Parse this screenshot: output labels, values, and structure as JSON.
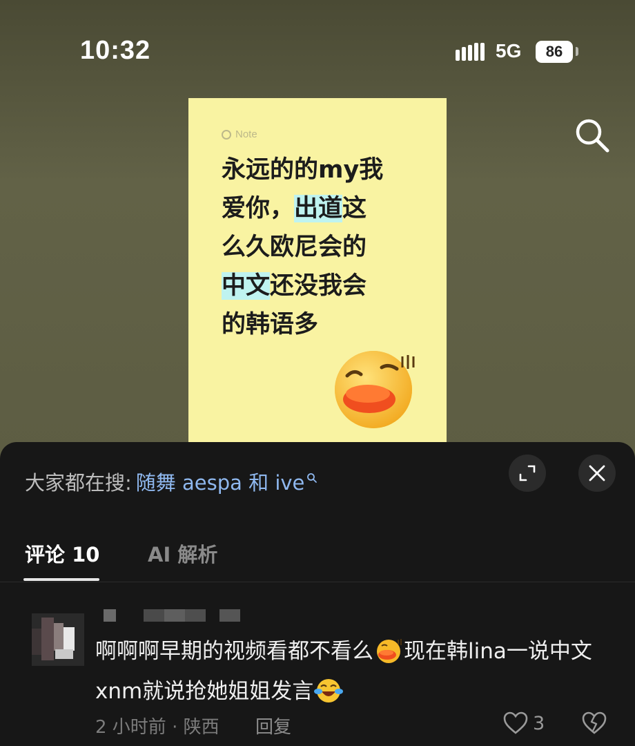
{
  "status_bar": {
    "time": "10:32",
    "network": "5G",
    "battery": "86"
  },
  "note": {
    "tag": "Note",
    "lines": [
      [
        {
          "t": "永远的的my我",
          "hl": false
        }
      ],
      [
        {
          "t": "爱你，",
          "hl": false
        },
        {
          "t": "出道",
          "hl": true
        },
        {
          "t": "这",
          "hl": false
        }
      ],
      [
        {
          "t": "么久欧尼会的",
          "hl": false
        }
      ],
      [
        {
          "t": "中文",
          "hl": true
        },
        {
          "t": "还没我会",
          "hl": false
        }
      ],
      [
        {
          "t": "的韩语多",
          "hl": false
        }
      ]
    ]
  },
  "panel": {
    "search_prefix": "大家都在搜:",
    "search_query": "随舞 aespa 和 ive",
    "tabs": {
      "comments": "评论 10",
      "ai": "AI 解析"
    }
  },
  "comment": {
    "text_1": "啊啊啊早期的视频看都不看么",
    "text_2": "现在韩lina一说中文xnm就说抢她姐姐发言",
    "time_location": "2 小时前 · 陕西",
    "reply": "回复",
    "likes": "3"
  },
  "colors": {
    "link": "#8fb8ef",
    "note_bg": "#f9f3a2",
    "highlight": "#bff3f0",
    "panel_bg": "#171717"
  }
}
